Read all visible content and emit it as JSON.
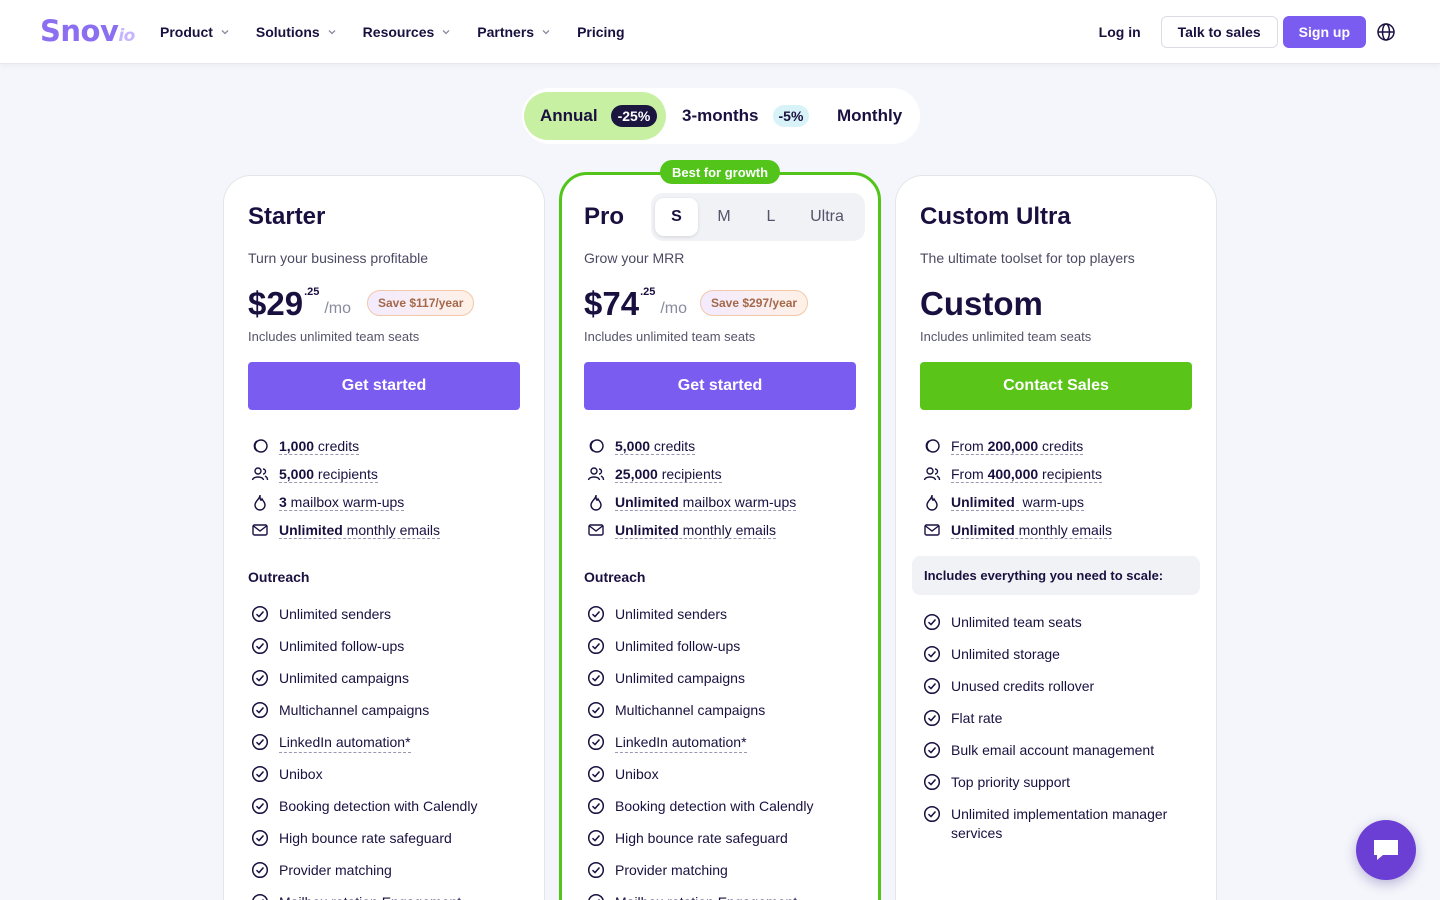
{
  "header": {
    "logo_main": "Snov",
    "logo_suffix": "io",
    "nav": [
      "Product",
      "Solutions",
      "Resources",
      "Partners",
      "Pricing"
    ],
    "login": "Log in",
    "talk_to_sales": "Talk to sales",
    "sign_up": "Sign up"
  },
  "billing": {
    "annual": "Annual",
    "annual_discount": "-25%",
    "three_months": "3-months",
    "three_months_discount": "-5%",
    "monthly": "Monthly",
    "selected": "Annual"
  },
  "plans": {
    "starter": {
      "title": "Starter",
      "subtitle": "Turn your business profitable",
      "price": "$29",
      "cents": ".25",
      "period": "/mo",
      "save": "Save $117/year",
      "seats": "Includes unlimited team seats",
      "cta": "Get started",
      "stats": [
        {
          "bold": "1,000",
          "rest": " credits"
        },
        {
          "bold": "5,000",
          "rest": " recipients"
        },
        {
          "bold": "3",
          "rest": " mailbox warm-ups"
        },
        {
          "bold": "Unlimited",
          "rest": " monthly emails"
        }
      ],
      "section": "Outreach",
      "features": [
        "Unlimited senders",
        "Unlimited follow-ups",
        "Unlimited campaigns",
        "Multichannel campaigns",
        "LinkedIn automation*",
        "Unibox",
        "Booking detection with Calendly",
        "High bounce rate safeguard",
        "Provider matching",
        "Mailbox rotation Engagement"
      ]
    },
    "pro": {
      "badge": "Best for growth",
      "title": "Pro",
      "sizes": [
        "S",
        "M",
        "L",
        "Ultra"
      ],
      "selected_size": "S",
      "subtitle": "Grow your MRR",
      "price": "$74",
      "cents": ".25",
      "period": "/mo",
      "save": "Save $297/year",
      "seats": "Includes unlimited team seats",
      "cta": "Get started",
      "stats": [
        {
          "bold": "5,000",
          "rest": " credits"
        },
        {
          "bold": "25,000",
          "rest": " recipients"
        },
        {
          "bold": "Unlimited",
          "rest": " mailbox warm-ups"
        },
        {
          "bold": "Unlimited",
          "rest": " monthly emails"
        }
      ],
      "section": "Outreach",
      "features": [
        "Unlimited senders",
        "Unlimited follow-ups",
        "Unlimited campaigns",
        "Multichannel campaigns",
        "LinkedIn automation*",
        "Unibox",
        "Booking detection with Calendly",
        "High bounce rate safeguard",
        "Provider matching",
        "Mailbox rotation Engagement"
      ]
    },
    "ultra": {
      "title": "Custom Ultra",
      "subtitle": "The ultimate toolset for top players",
      "price": "Custom",
      "seats": "Includes unlimited team seats",
      "cta": "Contact Sales",
      "stats": [
        {
          "pre": "From ",
          "bold": "200,000",
          "rest": " credits"
        },
        {
          "pre": "From ",
          "bold": "400,000",
          "rest": " recipients"
        },
        {
          "pre": "",
          "bold": "Unlimited",
          "rest": "  warm-ups"
        },
        {
          "pre": "",
          "bold": "Unlimited",
          "rest": " monthly emails"
        }
      ],
      "includes": "Includes everything you need to scale:",
      "features": [
        "Unlimited team seats",
        "Unlimited storage",
        "Unused credits rollover",
        "Flat rate",
        "Bulk email account management",
        "Top priority support",
        "Unlimited implementation manager services"
      ]
    }
  },
  "colors": {
    "brand_purple": "#7b5cf0",
    "green": "#52c41a",
    "cta_green": "#5bc419",
    "annual_bg": "#c8f0a2"
  }
}
